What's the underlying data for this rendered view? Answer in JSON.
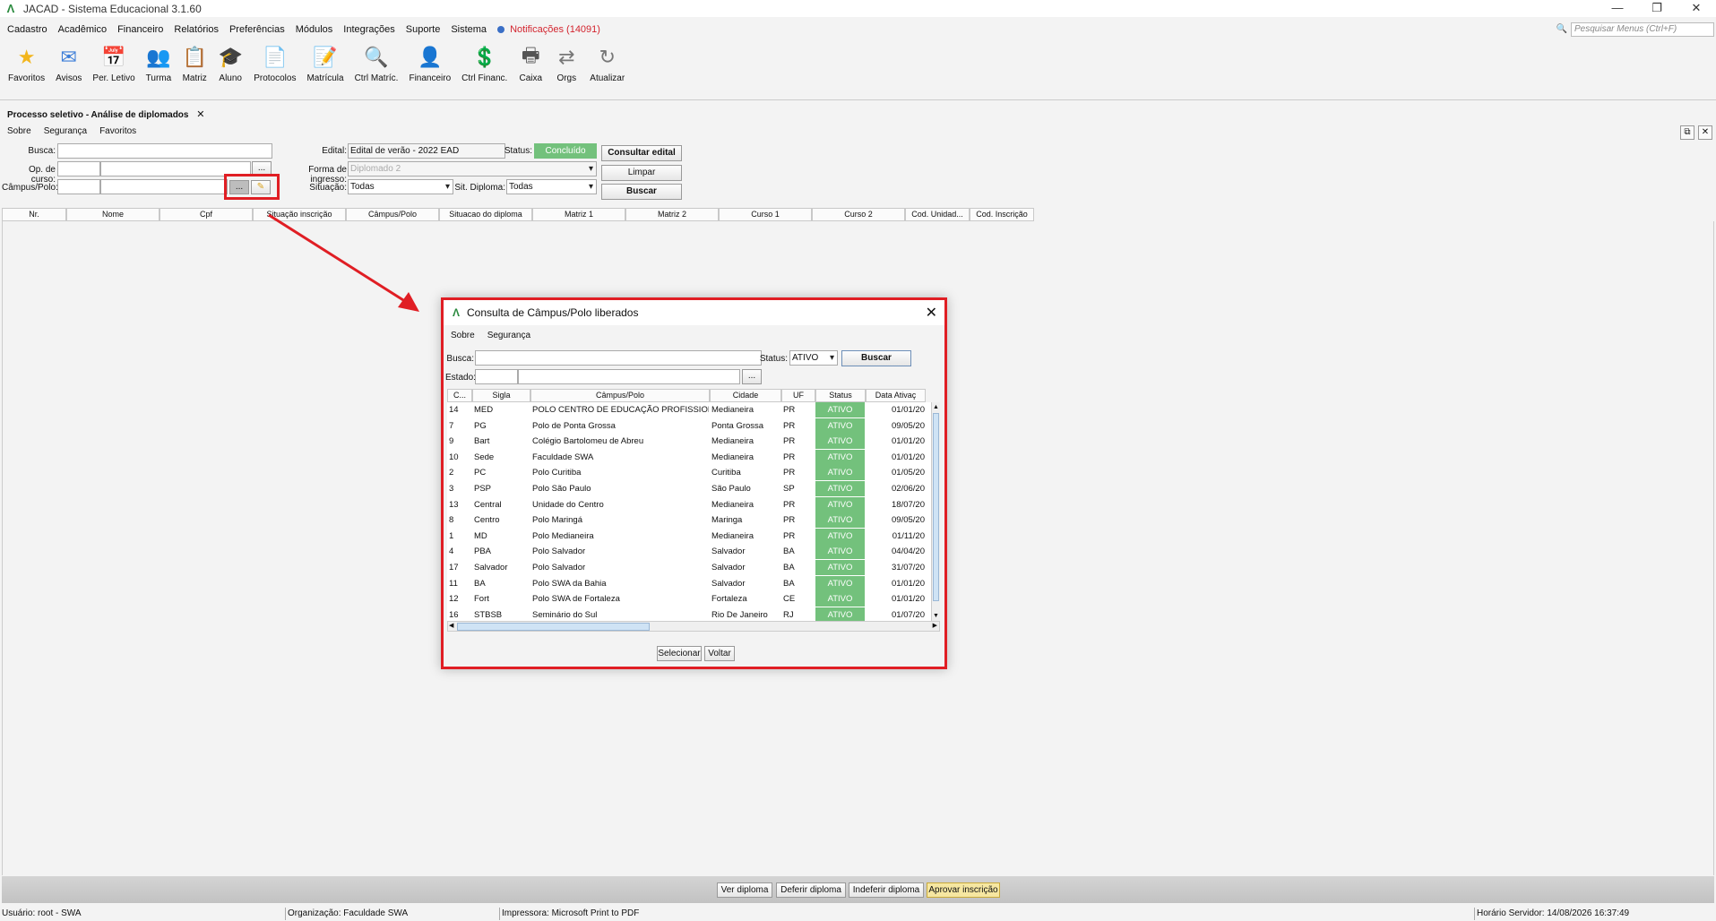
{
  "window": {
    "title": "JACAD - Sistema Educacional 3.1.60",
    "controls": [
      "—",
      "❐",
      "✕"
    ]
  },
  "menu": {
    "items": [
      "Cadastro",
      "Acadêmico",
      "Financeiro",
      "Relatórios",
      "Preferências",
      "Módulos",
      "Integrações",
      "Suporte",
      "Sistema"
    ],
    "notifications": "Notificações (14091)",
    "search_placeholder": "Pesquisar Menus (Ctrl+F)"
  },
  "toolbar": [
    {
      "label": "Favoritos",
      "icon": "star-icon",
      "glyph": "★",
      "color": "#f2b51c"
    },
    {
      "label": "Avisos",
      "icon": "mail-icon",
      "glyph": "✉",
      "color": "#3b7dd8"
    },
    {
      "label": "Per. Letivo",
      "icon": "calendar-icon",
      "glyph": "📅",
      "color": "#d47a2a"
    },
    {
      "label": "Turma",
      "icon": "group-icon",
      "glyph": "👥",
      "color": "#3b7dd8"
    },
    {
      "label": "Matriz",
      "icon": "matrix-icon",
      "glyph": "📋",
      "color": "#555"
    },
    {
      "label": "Aluno",
      "icon": "student-icon",
      "glyph": "🎓",
      "color": "#c07b2a"
    },
    {
      "label": "Protocolos",
      "icon": "protocol-icon",
      "glyph": "📄",
      "color": "#3b7dd8"
    },
    {
      "label": "Matrícula",
      "icon": "enrollment-icon",
      "glyph": "📝",
      "color": "#2f5fa8"
    },
    {
      "label": "Ctrl Matríc.",
      "icon": "enrollment-control-icon",
      "glyph": "🔍",
      "color": "#555"
    },
    {
      "label": "Financeiro",
      "icon": "finance-user-icon",
      "glyph": "👤",
      "color": "#2f5fa8"
    },
    {
      "label": "Ctrl Financ.",
      "icon": "finance-control-icon",
      "glyph": "💲",
      "color": "#2a8a3e"
    },
    {
      "label": "Caixa",
      "icon": "cash-register-icon",
      "glyph": "🖶",
      "color": "#555"
    },
    {
      "label": "Orgs",
      "icon": "swap-icon",
      "glyph": "⇄",
      "color": "#777"
    },
    {
      "label": "Atualizar",
      "icon": "refresh-icon",
      "glyph": "↻",
      "color": "#777"
    }
  ],
  "tab": {
    "label": "Processo seletivo - Análise de diplomados",
    "close": "✕"
  },
  "submenu": [
    "Sobre",
    "Segurança",
    "Favoritos"
  ],
  "form": {
    "busca_label": "Busca:",
    "op_curso_label": "Op. de curso:",
    "campus_label": "Câmpus/Polo:",
    "edital_label": "Edital:",
    "edital_value": "Edital de verão - 2022 EAD",
    "status_label": "Status:",
    "status_value": "Concluído",
    "forma_label": "Forma de ingresso:",
    "forma_value": "Diplomado 2",
    "situacao_label": "Situação:",
    "situacao_value": "Todas",
    "sit_diploma_label": "Sit. Diploma:",
    "sit_diploma_value": "Todas",
    "ellipsis": "...",
    "consultar_btn": "Consultar edital",
    "limpar_btn": "Limpar",
    "buscar_btn": "Buscar"
  },
  "grid_columns": [
    "Nr.",
    "Nome",
    "Cpf",
    "Situação inscrição",
    "Câmpus/Polo",
    "Situacao do diploma",
    "Matriz 1",
    "Matriz 2",
    "Curso 1",
    "Curso 2",
    "Cod. Unidad...",
    "Cod. Inscrição"
  ],
  "actions": [
    "Ver diploma",
    "Deferir diploma",
    "Indeferir diploma",
    "Aprovar inscrição"
  ],
  "status_bar": {
    "user": "Usuário: root - SWA",
    "org": "Organização: Faculdade SWA",
    "printer": "Impressora: Microsoft Print to PDF",
    "server_time": "Horário Servidor: 14/08/2026 16:37:49"
  },
  "dialog": {
    "title": "Consulta de Câmpus/Polo liberados",
    "menu": [
      "Sobre",
      "Segurança"
    ],
    "busca_label": "Busca:",
    "status_label": "Status:",
    "status_value": "ATIVO",
    "buscar_btn": "Buscar",
    "estado_label": "Estado:",
    "ellipsis": "...",
    "columns": [
      "C...",
      "Sigla",
      "Câmpus/Polo",
      "Cidade",
      "UF",
      "Status",
      "Data Ativaç"
    ],
    "rows": [
      [
        "14",
        "MED",
        " POLO CENTRO DE EDUCAÇÃO PROFISSION...",
        "Medianeira",
        "PR",
        "ATIVO",
        "01/01/20"
      ],
      [
        "7",
        "PG",
        "Polo de Ponta Grossa",
        "Ponta Grossa",
        "PR",
        "ATIVO",
        "09/05/20"
      ],
      [
        "9",
        "Bart",
        "Colégio Bartolomeu de Abreu",
        "Medianeira",
        "PR",
        "ATIVO",
        "01/01/20"
      ],
      [
        "10",
        "Sede",
        "Faculdade SWA",
        "Medianeira",
        "PR",
        "ATIVO",
        "01/01/20"
      ],
      [
        "2",
        "PC",
        "Polo Curitiba",
        "Curitiba",
        "PR",
        "ATIVO",
        "01/05/20"
      ],
      [
        "3",
        "PSP",
        "Polo São Paulo",
        "São Paulo",
        "SP",
        "ATIVO",
        "02/06/20"
      ],
      [
        "13",
        "Central",
        "Unidade do Centro",
        "Medianeira",
        "PR",
        "ATIVO",
        "18/07/20"
      ],
      [
        "8",
        "Centro",
        "Polo Maringá",
        "Maringa",
        "PR",
        "ATIVO",
        "09/05/20"
      ],
      [
        "1",
        "MD",
        "Polo Medianeira",
        "Medianeira",
        "PR",
        "ATIVO",
        "01/11/20"
      ],
      [
        "4",
        "PBA",
        "Polo Salvador",
        "Salvador",
        "BA",
        "ATIVO",
        "04/04/20"
      ],
      [
        "17",
        "Salvador",
        "Polo Salvador",
        "Salvador",
        "BA",
        "ATIVO",
        "31/07/20"
      ],
      [
        "11",
        "BA",
        "Polo SWA da Bahia",
        "Salvador",
        "BA",
        "ATIVO",
        "01/01/20"
      ],
      [
        "12",
        "Fort",
        "Polo SWA de Fortaleza",
        "Fortaleza",
        "CE",
        "ATIVO",
        "01/01/20"
      ],
      [
        "16",
        "STBSB",
        "Seminário do Sul",
        "Rio De Janeiro",
        "RJ",
        "ATIVO",
        "01/07/20"
      ]
    ],
    "selecionar_btn": "Selecionar",
    "voltar_btn": "Voltar"
  },
  "colors": {
    "accent_red": "#e01e24",
    "status_green": "#73c17c",
    "notification_red": "#d3242e"
  }
}
